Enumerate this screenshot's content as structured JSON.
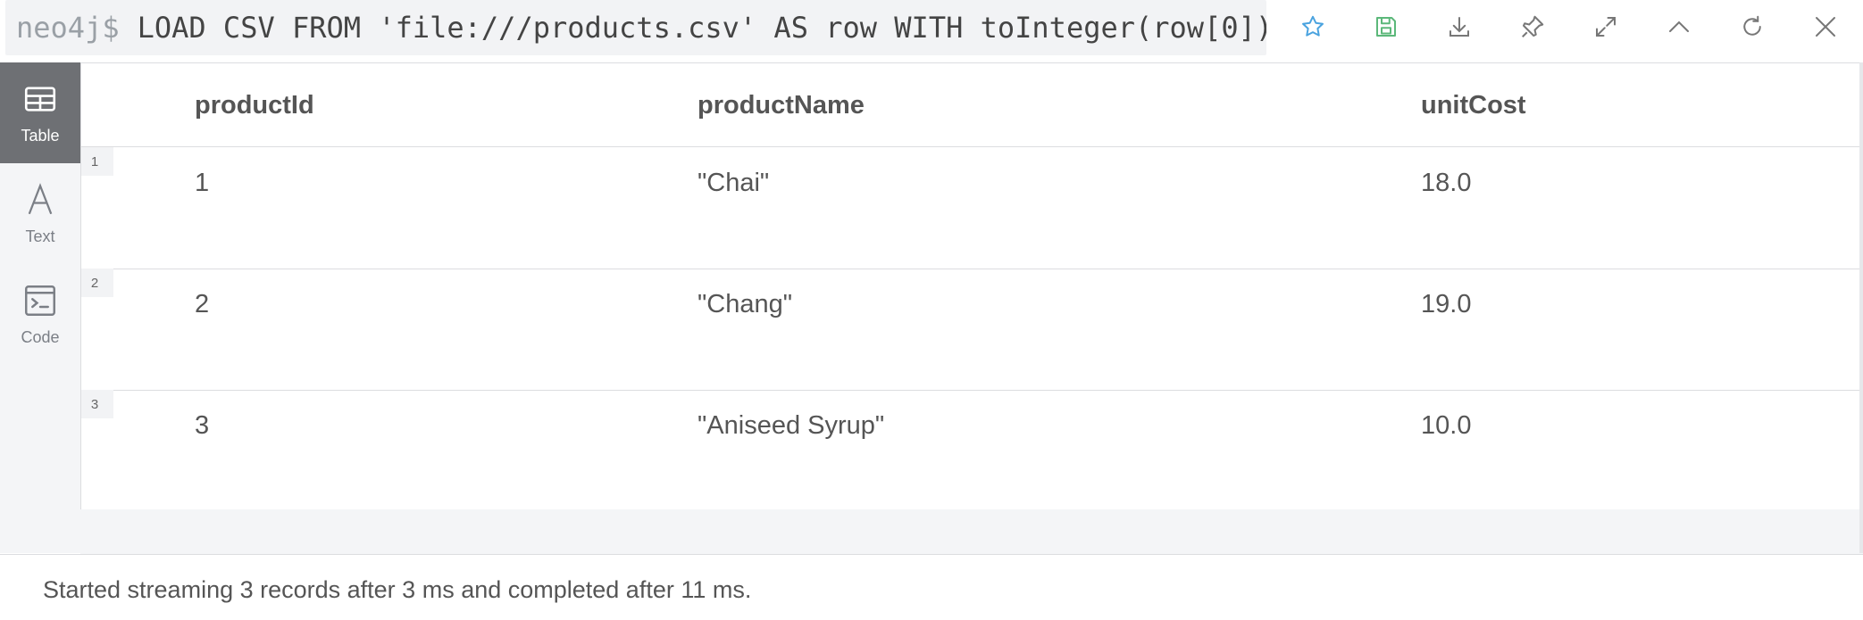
{
  "header": {
    "prompt": "neo4j$",
    "query": "LOAD CSV FROM 'file:///products.csv' AS row WITH toInteger(row[0])…"
  },
  "toolbar": {
    "icons": [
      "star-icon",
      "save-icon",
      "download-icon",
      "pin-icon",
      "expand-icon",
      "collapse-up-icon",
      "rerun-icon",
      "close-icon"
    ],
    "accent_star": "#4aa3df",
    "accent_save": "#5cb87a"
  },
  "views": [
    {
      "label": "Table",
      "icon": "table-icon",
      "active": true
    },
    {
      "label": "Text",
      "icon": "text-icon",
      "active": false
    },
    {
      "label": "Code",
      "icon": "code-icon",
      "active": false
    }
  ],
  "table": {
    "columns": [
      "productId",
      "productName",
      "unitCost"
    ],
    "rows": [
      {
        "num": "1",
        "cells": [
          "1",
          "\"Chai\"",
          "18.0"
        ]
      },
      {
        "num": "2",
        "cells": [
          "2",
          "\"Chang\"",
          "19.0"
        ]
      },
      {
        "num": "3",
        "cells": [
          "3",
          "\"Aniseed Syrup\"",
          "10.0"
        ]
      }
    ]
  },
  "status": {
    "text": "Started streaming 3 records after 3 ms and completed after 11 ms."
  }
}
